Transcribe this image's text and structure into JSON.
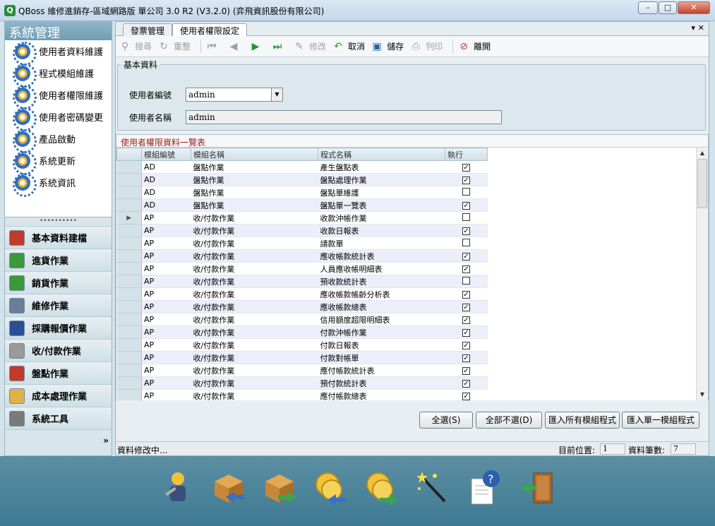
{
  "window": {
    "title": "QBoss 維修進銷存-區域網路版 單公司 3.0 R2 (V3.2.0) (弈飛資訊股份有限公司)",
    "minimize": "–",
    "maximize": "□",
    "close": "✕"
  },
  "sidebar": {
    "header": "系統管理",
    "items": [
      {
        "label": "使用者資料維護"
      },
      {
        "label": "程式模組維護"
      },
      {
        "label": "使用者權限維護"
      },
      {
        "label": "使用者密碼變更"
      },
      {
        "label": "產品啟動"
      },
      {
        "label": "系統更新"
      },
      {
        "label": "系統資訊"
      }
    ],
    "modules": [
      {
        "label": "基本資料建檔",
        "color": "#c23b2a"
      },
      {
        "label": "進貨作業",
        "color": "#3a9a3a"
      },
      {
        "label": "銷貨作業",
        "color": "#3a9a3a"
      },
      {
        "label": "維修作業",
        "color": "#6a7f9a"
      },
      {
        "label": "採購報價作業",
        "color": "#2c4f9a"
      },
      {
        "label": "收/付款作業",
        "color": "#9a9a9a"
      },
      {
        "label": "盤點作業",
        "color": "#c23b2a"
      },
      {
        "label": "成本處理作業",
        "color": "#e0b34a"
      },
      {
        "label": "系統工具",
        "color": "#7a7a7a"
      },
      {
        "label": "系統管理",
        "color": "#2f6fc1"
      }
    ],
    "more": "»"
  },
  "tabs": [
    {
      "label": "發票管理"
    },
    {
      "label": "使用者權限設定"
    }
  ],
  "tab_controls": "▾ ✕",
  "toolbar": {
    "search": "搜尋",
    "reset": "重整",
    "edit": "修改",
    "cancel": "取消",
    "save": "儲存",
    "print": "列印",
    "exit": "離開"
  },
  "basic": {
    "legend": "基本資料",
    "user_id_label": "使用者編號",
    "user_id_value": "admin",
    "user_name_label": "使用者名稱",
    "user_name_value": "admin"
  },
  "grid": {
    "title": "使用者權限資料一覽表",
    "columns": [
      "模組編號",
      "模組名稱",
      "程式名稱",
      "執行"
    ],
    "rows": [
      {
        "mod": "AD",
        "name": "盤點作業",
        "prog": "產生盤點表",
        "run": true
      },
      {
        "mod": "AD",
        "name": "盤點作業",
        "prog": "盤點處理作業",
        "run": true
      },
      {
        "mod": "AD",
        "name": "盤點作業",
        "prog": "盤點單維護",
        "run": false
      },
      {
        "mod": "AD",
        "name": "盤點作業",
        "prog": "盤點單一覽表",
        "run": true
      },
      {
        "mod": "AP",
        "name": "收/付款作業",
        "prog": "收款沖帳作業",
        "run": false
      },
      {
        "mod": "AP",
        "name": "收/付款作業",
        "prog": "收款日報表",
        "run": true
      },
      {
        "mod": "AP",
        "name": "收/付款作業",
        "prog": "請款單",
        "run": false
      },
      {
        "mod": "AP",
        "name": "收/付款作業",
        "prog": "應收帳款統計表",
        "run": true
      },
      {
        "mod": "AP",
        "name": "收/付款作業",
        "prog": "人員應收帳明細表",
        "run": true
      },
      {
        "mod": "AP",
        "name": "收/付款作業",
        "prog": "預收款統計表",
        "run": false
      },
      {
        "mod": "AP",
        "name": "收/付款作業",
        "prog": "應收帳款帳齡分析表",
        "run": true
      },
      {
        "mod": "AP",
        "name": "收/付款作業",
        "prog": "應收帳款總表",
        "run": true
      },
      {
        "mod": "AP",
        "name": "收/付款作業",
        "prog": "信用額度超限明細表",
        "run": true
      },
      {
        "mod": "AP",
        "name": "收/付款作業",
        "prog": "付款沖帳作業",
        "run": true
      },
      {
        "mod": "AP",
        "name": "收/付款作業",
        "prog": "付款日報表",
        "run": true
      },
      {
        "mod": "AP",
        "name": "收/付款作業",
        "prog": "付款對帳單",
        "run": true
      },
      {
        "mod": "AP",
        "name": "收/付款作業",
        "prog": "應付帳款統計表",
        "run": true
      },
      {
        "mod": "AP",
        "name": "收/付款作業",
        "prog": "預付款統計表",
        "run": true
      },
      {
        "mod": "AP",
        "name": "收/付款作業",
        "prog": "應付帳款總表",
        "run": true
      }
    ]
  },
  "buttons": {
    "select_all": "全選(S)",
    "deselect_all": "全部不選(D)",
    "import_all": "匯入所有模組程式",
    "import_one": "匯入單一模組程式"
  },
  "status": {
    "message": "資料修改中...",
    "position_label": "目前位置:",
    "position_value": "1",
    "count_label": "資料筆數:",
    "count_value": "7"
  },
  "dock": {
    "icons": [
      "worker-icon",
      "import-box-icon",
      "export-box-icon",
      "coins-in-icon",
      "coins-out-icon",
      "magic-wand-icon",
      "help-document-icon",
      "exit-door-icon"
    ]
  }
}
